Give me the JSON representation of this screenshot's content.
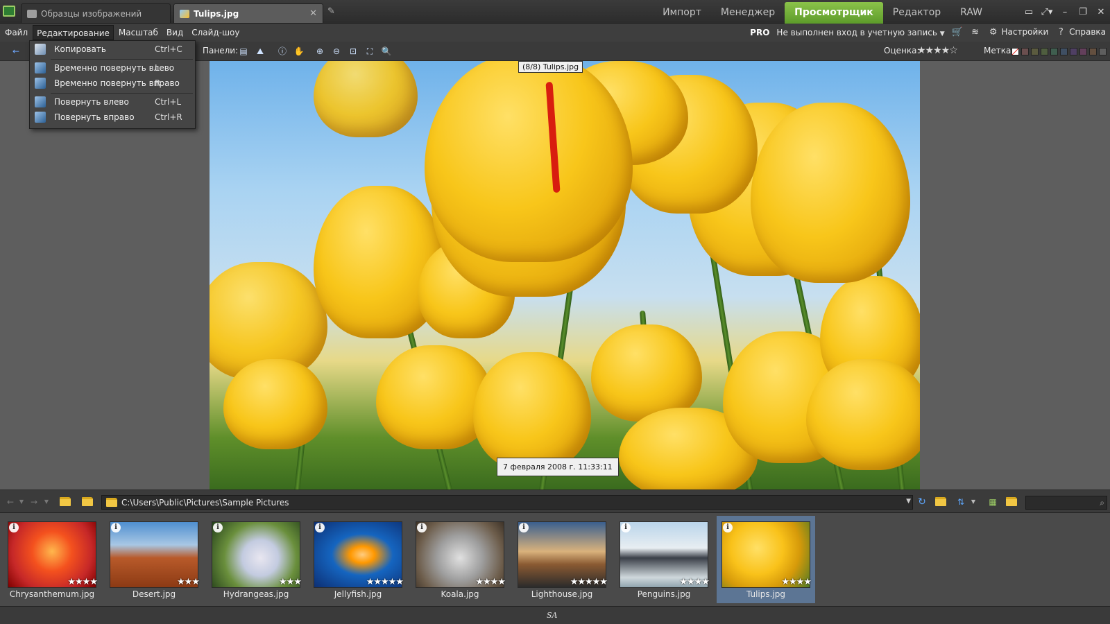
{
  "titlebar": {
    "tabs": [
      {
        "label": "Образцы изображений",
        "active": false
      },
      {
        "label": "Tulips.jpg",
        "active": true
      }
    ],
    "modes": [
      {
        "label": "Импорт"
      },
      {
        "label": "Менеджер"
      },
      {
        "label": "Просмотрщик",
        "active": true
      },
      {
        "label": "Редактор"
      },
      {
        "label": "RAW"
      }
    ],
    "accent_color": "#7ab33a"
  },
  "menubar": {
    "items": [
      "Файл",
      "Редактирование",
      "Масштаб",
      "Вид",
      "Слайд-шоу"
    ],
    "pro": "PRO",
    "account": "Не выполнен вход в учетную запись",
    "settings": "Настройки",
    "help": "Справка"
  },
  "toolbar": {
    "panels_label": "Панели:",
    "rating_label": "Оценка:",
    "rating_stars": 4,
    "tag_label": "Метка:",
    "tag_colors": [
      "#6b4f4f",
      "#5b5b3f",
      "#4f5e3f",
      "#3f5e4f",
      "#3f4f63",
      "#4f3f63",
      "#633f5b",
      "#634f3f",
      "#5e5e5e"
    ]
  },
  "edit_menu": {
    "items": [
      {
        "label": "Копировать",
        "shortcut": "Ctrl+C"
      },
      {
        "label": "Временно повернуть влево",
        "shortcut": "L"
      },
      {
        "label": "Временно повернуть вправо",
        "shortcut": "R"
      },
      {
        "label": "Повернуть влево",
        "shortcut": "Ctrl+L"
      },
      {
        "label": "Повернуть вправо",
        "shortcut": "Ctrl+R"
      }
    ]
  },
  "viewer": {
    "image_index": "(8/8) Tulips.jpg",
    "date": "7 февраля 2008 г. 11:33:11"
  },
  "browser": {
    "path": "C:\\Users\\Public\\Pictures\\Sample Pictures",
    "thumbnails": [
      {
        "name": "Chrysanthemum.jpg",
        "stars": 4
      },
      {
        "name": "Desert.jpg",
        "stars": 3
      },
      {
        "name": "Hydrangeas.jpg",
        "stars": 3
      },
      {
        "name": "Jellyfish.jpg",
        "stars": 5
      },
      {
        "name": "Koala.jpg",
        "stars": 4
      },
      {
        "name": "Lighthouse.jpg",
        "stars": 5
      },
      {
        "name": "Penguins.jpg",
        "stars": 4
      },
      {
        "name": "Tulips.jpg",
        "stars": 4,
        "selected": true
      }
    ]
  },
  "statusbar": {
    "center": "SA"
  }
}
